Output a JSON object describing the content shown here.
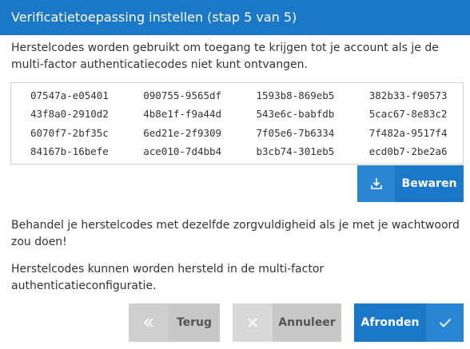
{
  "dialog": {
    "title": "Verificatietoepassing instellen (stap 5 van 5)",
    "intro": "Herstelcodes worden gebruikt om toegang te krijgen tot je account als je de multi-factor authenticatiecodes niet kunt ontvangen.",
    "codes": [
      "07547a-e05401",
      "090755-9565df",
      "1593b8-869eb5",
      "382b33-f90573",
      "43f8a0-2910d2",
      "4b8e1f-f9a44d",
      "543e6c-babfdb",
      "5cac67-8e83c2",
      "6070f7-2bf35c",
      "6ed21e-2f9309",
      "7f05e6-7b6334",
      "7f482a-9517f4",
      "84167b-16befe",
      "ace010-7d4bb4",
      "b3cb74-301eb5",
      "ecd0b7-2be2a6"
    ],
    "save_label": "Bewaren",
    "paragraph1": "Behandel je herstelcodes met dezelfde zorgvuldigheid als je met je wachtwoord zou doen!",
    "paragraph2": "Herstelcodes kunnen worden hersteld in de multi-factor authenticatieconfiguratie."
  },
  "footer": {
    "back_label": "Terug",
    "cancel_label": "Annuleer",
    "finish_label": "Afronden"
  },
  "icons": {
    "save": "download-icon",
    "back": "double-chevron-left-icon",
    "cancel": "close-icon",
    "finish": "checkmark-icon"
  },
  "colors": {
    "primary": "#1b78c8",
    "primary_light": "#2a86d3",
    "secondary": "#d9d9d9"
  }
}
